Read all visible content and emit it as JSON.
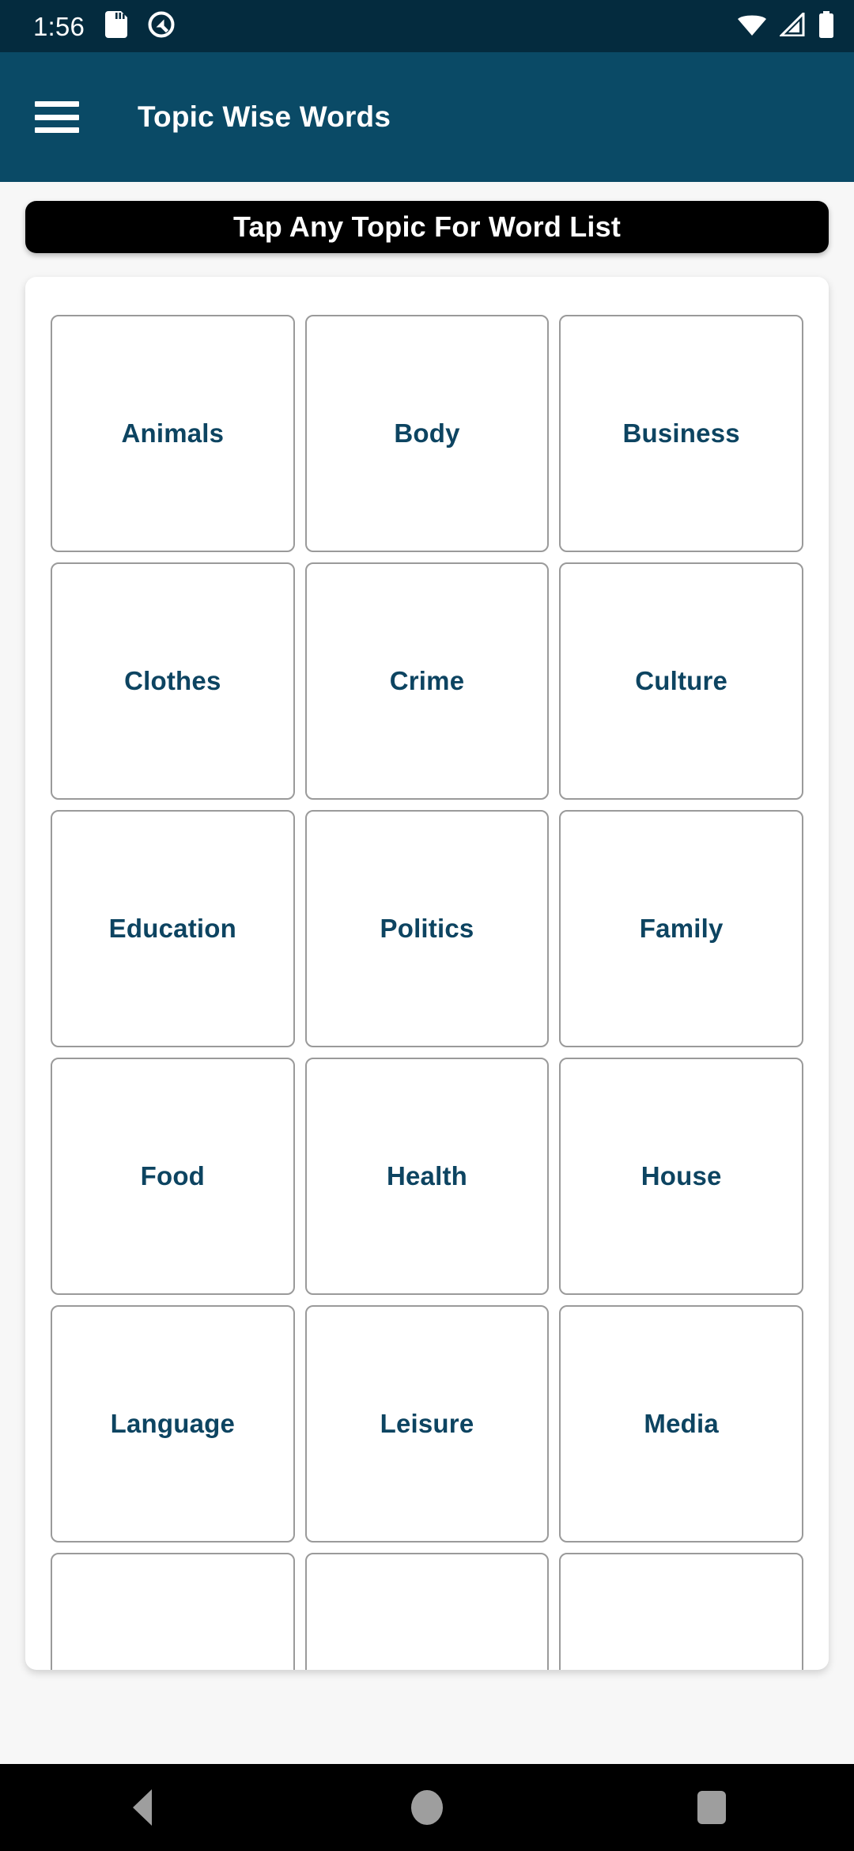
{
  "status_bar": {
    "clock": "1:56",
    "left_icons": [
      "sd-card-icon",
      "quick-settings-icon"
    ],
    "right_icons": [
      "wifi-icon",
      "cellular-signal-icon",
      "battery-icon"
    ],
    "background_color": "#042B3E"
  },
  "app_bar": {
    "menu_icon": "hamburger-menu-icon",
    "title": "Topic Wise Words",
    "background_color": "#0A4A66"
  },
  "banner": {
    "text": "Tap Any Topic For Word List",
    "background_color": "#000000",
    "text_color": "#FFFFFF"
  },
  "topics": {
    "text_color": "#0D4461",
    "border_color": "#9A9A9A",
    "items": [
      {
        "label": "Animals"
      },
      {
        "label": "Body"
      },
      {
        "label": "Business"
      },
      {
        "label": "Clothes"
      },
      {
        "label": "Crime"
      },
      {
        "label": "Culture"
      },
      {
        "label": "Education"
      },
      {
        "label": "Politics"
      },
      {
        "label": "Family"
      },
      {
        "label": "Food"
      },
      {
        "label": "Health"
      },
      {
        "label": "House"
      },
      {
        "label": "Language"
      },
      {
        "label": "Leisure"
      },
      {
        "label": "Media"
      },
      {
        "label": ""
      },
      {
        "label": ""
      },
      {
        "label": ""
      }
    ]
  },
  "nav_bar": {
    "back": "back-nav-icon",
    "home": "home-nav-icon",
    "recents": "recents-nav-icon",
    "background_color": "#000000",
    "icon_color": "#9E9E9E"
  }
}
